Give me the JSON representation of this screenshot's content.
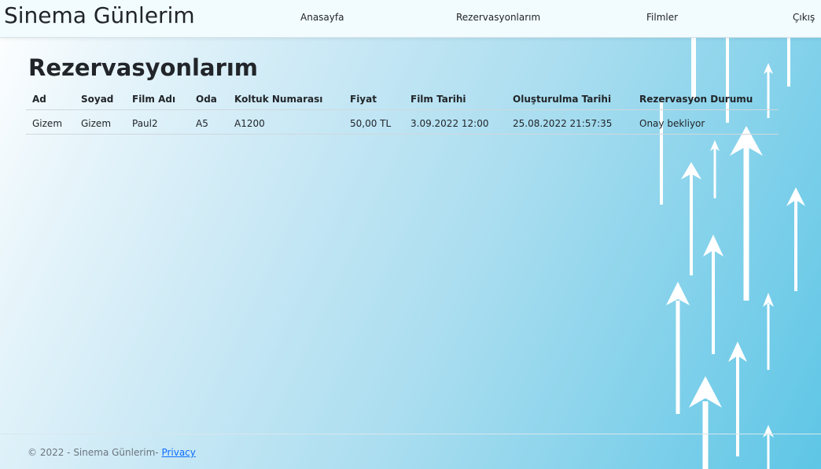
{
  "navbar": {
    "brand": "Sinema Günlerim",
    "links": [
      "Anasayfa",
      "Rezervasyonlarım",
      "Filmler",
      "Çıkış"
    ]
  },
  "main": {
    "title": "Rezervasyonlarım",
    "table": {
      "headers": [
        "Ad",
        "Soyad",
        "Film Adı",
        "Oda",
        "Koltuk Numarası",
        "Fiyat",
        "Film Tarihi",
        "Oluşturulma Tarihi",
        "Rezervasyon Durumu"
      ],
      "rows": [
        [
          "Gizem",
          "Gizem",
          "Paul2",
          "A5",
          "A1200",
          "50,00 TL",
          "3.09.2022 12:00",
          "25.08.2022 21:57:35",
          "Onay bekliyor"
        ]
      ]
    }
  },
  "footer": {
    "text": "© 2022 - Sinema Günlerim- ",
    "link": "Privacy"
  },
  "decoration": {
    "icon": "upward-arrows-graphic",
    "color": "#ffffff"
  }
}
